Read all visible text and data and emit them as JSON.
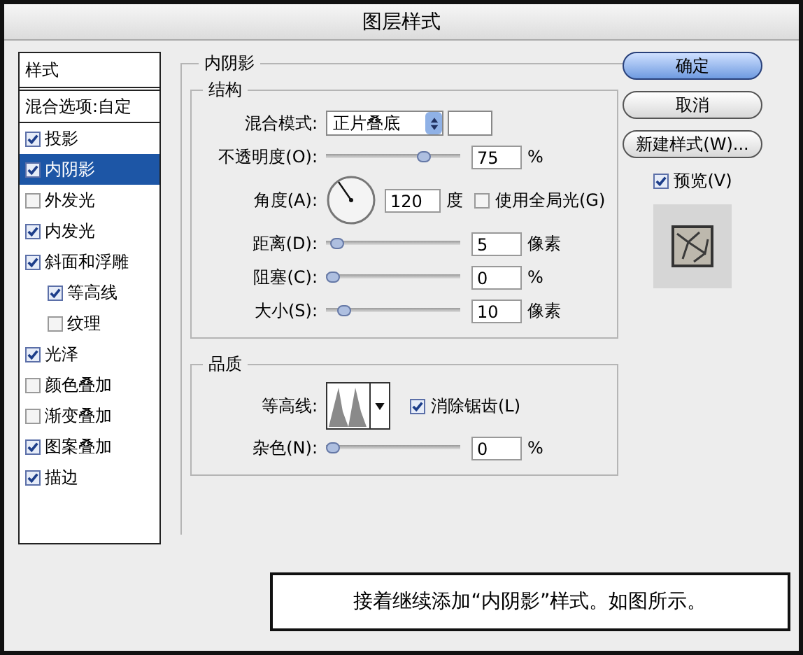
{
  "window": {
    "title": "图层样式"
  },
  "sidebar": {
    "header": "样式",
    "blend_options": "混合选项:自定",
    "items": [
      {
        "label": "投影",
        "checked": true,
        "selected": false
      },
      {
        "label": "内阴影",
        "checked": true,
        "selected": true
      },
      {
        "label": "外发光",
        "checked": false,
        "selected": false
      },
      {
        "label": "内发光",
        "checked": true,
        "selected": false
      },
      {
        "label": "斜面和浮雕",
        "checked": true,
        "selected": false,
        "children": [
          {
            "label": "等高线",
            "checked": true,
            "selected": false
          },
          {
            "label": "纹理",
            "checked": false,
            "selected": false
          }
        ]
      },
      {
        "label": "光泽",
        "checked": true,
        "selected": false
      },
      {
        "label": "颜色叠加",
        "checked": false,
        "selected": false
      },
      {
        "label": "渐变叠加",
        "checked": false,
        "selected": false
      },
      {
        "label": "图案叠加",
        "checked": true,
        "selected": false
      },
      {
        "label": "描边",
        "checked": true,
        "selected": false
      }
    ]
  },
  "panel": {
    "title": "内阴影",
    "structure": {
      "title": "结构",
      "rows": [
        {
          "kind": "select",
          "label": "混合模式:",
          "value": "正片叠底"
        },
        {
          "kind": "slider",
          "label": "不透明度(O):",
          "level": 0.75,
          "value": "75",
          "unit": "%"
        },
        {
          "kind": "angle",
          "label": "角度(A):",
          "value": "120",
          "unit": "度",
          "option": {
            "label": "使用全局光(G)",
            "checked": false
          }
        },
        {
          "kind": "slider",
          "label": "距离(D):",
          "level": 0.03,
          "value": "5",
          "unit": "像素"
        },
        {
          "kind": "slider",
          "label": "阻塞(C):",
          "level": 0,
          "value": "0",
          "unit": "%"
        },
        {
          "kind": "slider",
          "label": "大小(S):",
          "level": 0.09,
          "value": "10",
          "unit": "像素"
        }
      ]
    },
    "quality": {
      "title": "品质",
      "rows": [
        {
          "kind": "contour",
          "label": "等高线:",
          "option": {
            "label": "消除锯齿(L)",
            "checked": true
          }
        },
        {
          "kind": "slider",
          "label": "杂色(N):",
          "level": 0,
          "value": "0",
          "unit": "%"
        }
      ]
    }
  },
  "buttons": [
    {
      "label": "确定",
      "default": true
    },
    {
      "label": "取消",
      "default": false
    },
    {
      "label": "新建样式(W)...",
      "default": false
    }
  ],
  "preview": {
    "label": "预览(V)",
    "checked": true
  },
  "caption": "接着继续添加“内阴影”样式。如图所示。"
}
